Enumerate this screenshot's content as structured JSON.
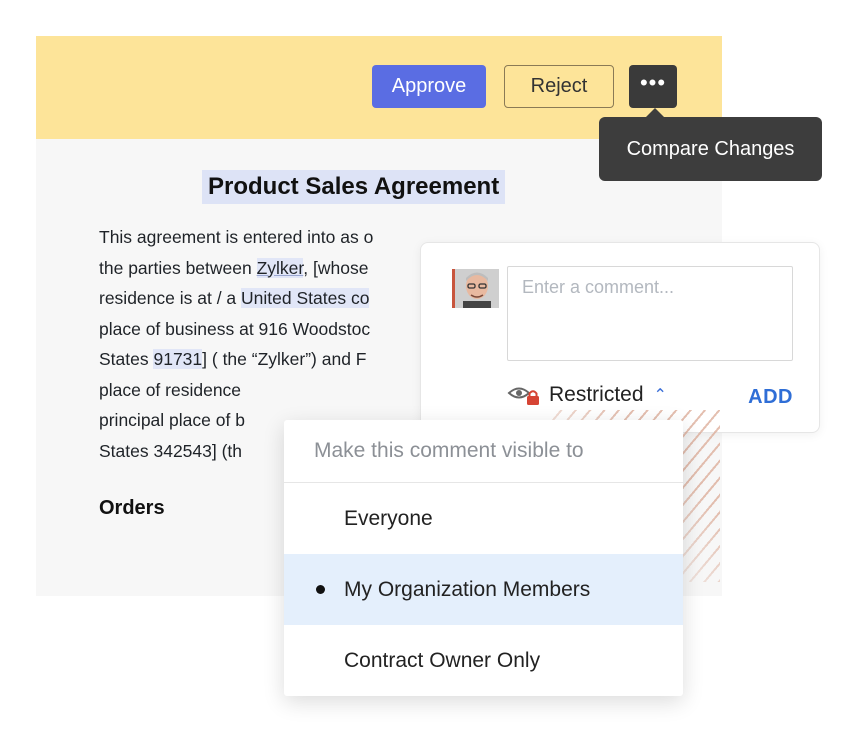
{
  "toolbar": {
    "approve_label": "Approve",
    "reject_label": "Reject",
    "more_label": "•••",
    "tooltip": "Compare Changes"
  },
  "document": {
    "title": "Product Sales Agreement",
    "lines": [
      [
        "This agreement is entered into as o"
      ],
      [
        "the parties between ",
        "Zylker",
        ", [whose"
      ],
      [
        "residence is at / a ",
        "United States co"
      ],
      [
        "place of business at 916 Woodstoc"
      ],
      [
        "States ",
        "91731",
        "] ( the “Zylker”) and  F"
      ],
      [
        "place of residence"
      ],
      [
        "principal place of b"
      ],
      [
        "States 342543] (th"
      ]
    ],
    "section_heading": "Orders"
  },
  "comment": {
    "placeholder": "Enter a comment...",
    "visibility_label": "Restricted",
    "add_label": "ADD"
  },
  "visibility_menu": {
    "header": "Make this comment visible to",
    "options": [
      {
        "label": "Everyone",
        "selected": false
      },
      {
        "label": "My Organization Members",
        "selected": true
      },
      {
        "label": "Contract Owner Only",
        "selected": false
      }
    ]
  },
  "colors": {
    "toolbar_bg": "#fde499",
    "approve_bg": "#5a6de3",
    "tooltip_bg": "#3d3d3d",
    "accent_link": "#2f6ed6",
    "selected_option_bg": "#e4effc",
    "highlight": "#e1e6f7"
  }
}
